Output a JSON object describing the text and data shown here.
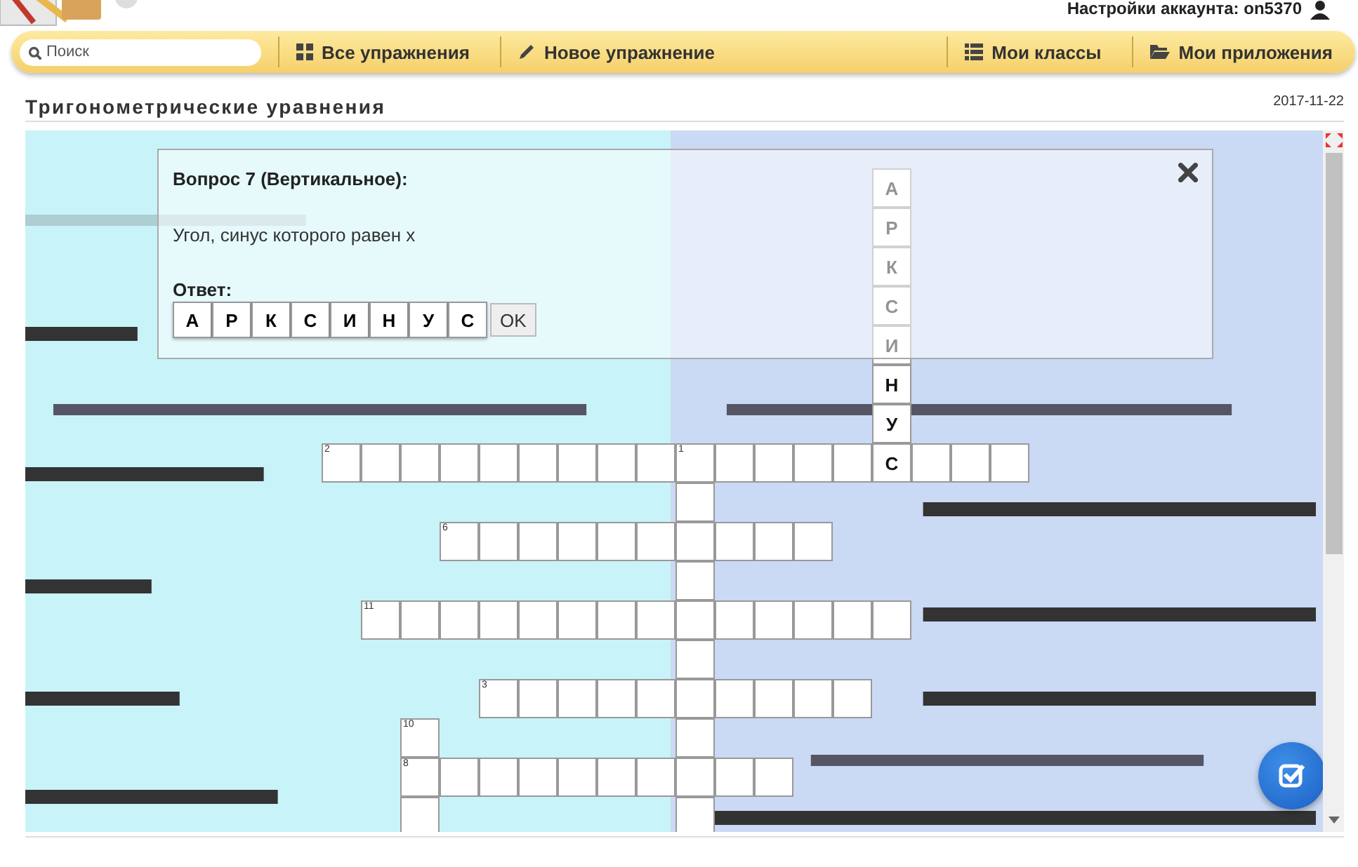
{
  "header": {
    "account_label": "Настройки аккаунта: on5370"
  },
  "nav": {
    "search": {
      "placeholder": "Поиск"
    },
    "items": [
      {
        "label": "Все упражнения",
        "kind": "grid"
      },
      {
        "label": "Новое упражнение",
        "kind": "pencil"
      },
      {
        "label": "Мои классы",
        "kind": "list"
      },
      {
        "label": "Мои приложения",
        "kind": "folder"
      }
    ]
  },
  "exercise": {
    "title": "Тригонометрические уравнения",
    "date": "2017-11-22"
  },
  "dialog": {
    "title": "Вопрос 7 (Вертикальное):",
    "clue": "Угол, синус которого равен x",
    "answer_label": "Ответ:",
    "answer_letters": [
      "А",
      "Р",
      "К",
      "С",
      "И",
      "Н",
      "У",
      "С"
    ],
    "ok_button": "OK"
  },
  "crossword": {
    "words": [
      {
        "number": "2",
        "kind": "across"
      },
      {
        "number": "1",
        "kind": "across"
      },
      {
        "kind": "down"
      },
      {
        "number": "6",
        "kind": "across"
      },
      {
        "number": "11",
        "kind": "across"
      },
      {
        "number": "3",
        "kind": "across"
      },
      {
        "number": "10",
        "kind": "down"
      },
      {
        "number": "8",
        "kind": "across"
      },
      {
        "kind": "down",
        "letters": [
          "А",
          "Р",
          "К",
          "С",
          "И",
          "Н",
          "У",
          "С"
        ]
      }
    ]
  }
}
